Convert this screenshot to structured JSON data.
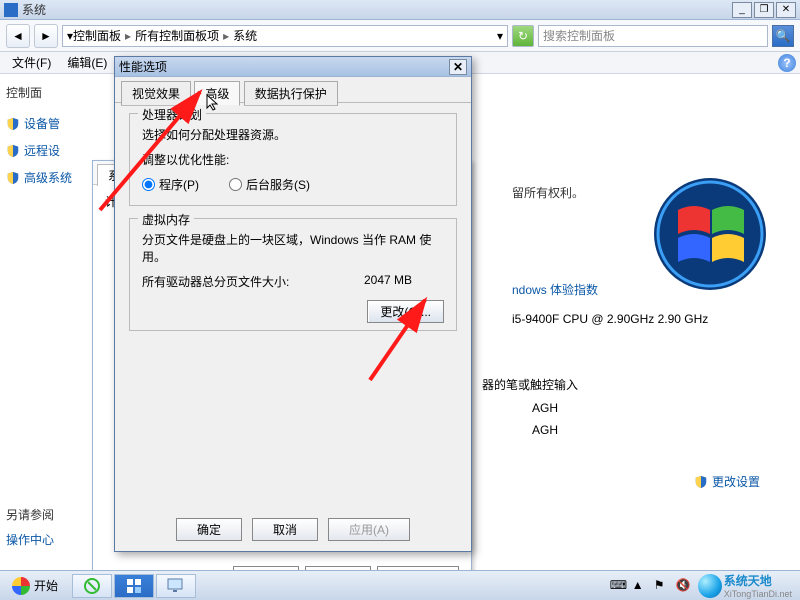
{
  "window": {
    "title": "系统",
    "min": "_",
    "restore": "❐",
    "close": "✕"
  },
  "nav": {
    "back": "◄",
    "fwd": "►",
    "refresh": "↻",
    "breadcrumb": {
      "a": "控制面板",
      "b": "所有控制面板项",
      "c": "系统"
    },
    "search_placeholder": "搜索控制面板",
    "search_icon": "🔍"
  },
  "menu": {
    "file": "文件(F)",
    "edit": "编辑(E)",
    "help": "?"
  },
  "sidebar": {
    "home": "控制面",
    "items": [
      "设备管",
      "远程设",
      "高级系统"
    ],
    "see_also": "另请参阅",
    "action_center": "操作中心"
  },
  "behind_window": {
    "tab": "系统",
    "label": "计"
  },
  "mainpane": {
    "rights": "留所有权利。",
    "wei": "ndows 体验指数",
    "cpu": "i5-9400F CPU @ 2.90GHz   2.90 GHz",
    "pen": "器的笔或触控输入",
    "agh1": "AGH",
    "agh2": "AGH",
    "change_settings": "更改设置"
  },
  "dialog": {
    "title": "性能选项",
    "tabs": {
      "visual": "视觉效果",
      "advanced": "高级",
      "dep": "数据执行保护"
    },
    "scheduling": {
      "legend": "处理器计划",
      "desc": "选择如何分配处理器资源。",
      "optimize_label": "调整以优化性能:",
      "programs": "程序(P)",
      "background": "后台服务(S)"
    },
    "vm": {
      "legend": "虚拟内存",
      "desc": "分页文件是硬盘上的一块区域，Windows 当作 RAM 使用。",
      "total_label": "所有驱动器总分页文件大小:",
      "total_value": "2047 MB",
      "change": "更改(C)..."
    },
    "buttons": {
      "ok": "确定",
      "cancel": "取消",
      "apply": "应用(A)"
    }
  },
  "taskbar": {
    "start": "开始",
    "watermark_top": "系统天地",
    "watermark_bottom": "XiTongTianDi.net"
  }
}
